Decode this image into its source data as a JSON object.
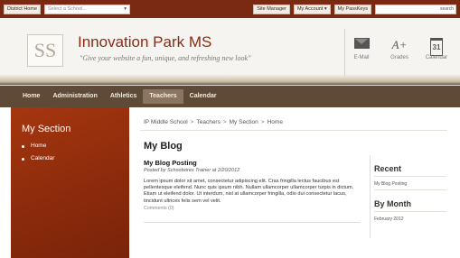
{
  "topbar": {
    "district_home": "District Home",
    "school_select": "Select a School...",
    "site_manager": "Site Manager",
    "my_account": "My Account",
    "my_passkeys": "My PassKeys",
    "search_label": "search"
  },
  "header": {
    "logo_text": "SS",
    "title": "Innovation Park MS",
    "tagline": "\"Give your website a fun, unique, and refreshing new look\"",
    "icons": [
      {
        "name": "mail-icon",
        "label": "E-Mail"
      },
      {
        "name": "grades-icon",
        "label": "Grades",
        "glyph": "A+"
      },
      {
        "name": "calendar-icon",
        "label": "Calendar",
        "glyph": "31"
      }
    ]
  },
  "nav": {
    "items": [
      "Home",
      "Administration",
      "Athletics",
      "Teachers",
      "Calendar"
    ],
    "active": "Teachers"
  },
  "sidebar": {
    "title": "My Section",
    "items": [
      "Home",
      "Calendar"
    ]
  },
  "breadcrumb": [
    "IP Middle School",
    "Teachers",
    "My Section",
    "Home"
  ],
  "main": {
    "page_title": "My Blog",
    "post": {
      "title": "My Blog Posting",
      "meta": "Posted by Schoolwires Trainer at 2/20/2012",
      "body": "Lorem ipsum dolor sit amet, consectetur adipiscing elit. Cras fringilla lectus faucibus est pellentesque eleifend. Nunc quis ipsum nibh. Nullam ullamcorper ullamcorper turpis in dictum. Etiam ut eleifend dolor. Ut interdum, nisl at ullamcorper fringilla, odio dui consectetur lacus, tincidunt ultrices felis sem vel velit.",
      "comments": "Comments (0)"
    }
  },
  "right_col": {
    "recent_heading": "Recent",
    "recent_link": "My Blog Posting",
    "month_heading": "By Month",
    "month_link": "February 2012"
  },
  "colors": {
    "topbar": "#7a2a12",
    "brand_title": "#8a2c12",
    "nav_bg": "#5e4a36",
    "sidebar": "#a5360f"
  }
}
